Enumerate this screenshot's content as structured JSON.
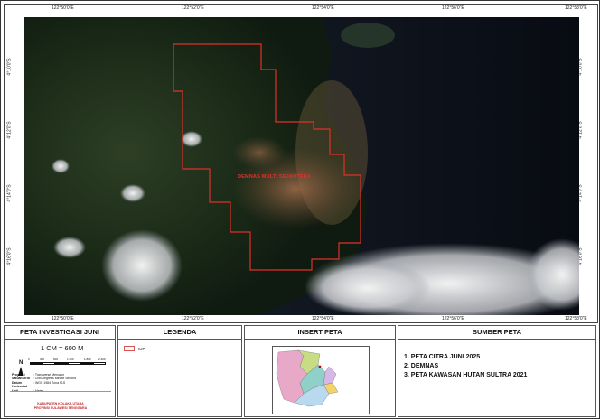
{
  "map": {
    "title": "PETA INVESTIGASI JUNI",
    "area_label": "DEMNAS MULTI SEJAHTERA",
    "top_coords": [
      "122°50'0\"E",
      "122°52'0\"E",
      "122°54'0\"E",
      "122°56'0\"E",
      "122°58'0\"E"
    ],
    "bottom_coords": [
      "122°50'0\"E",
      "122°52'0\"E",
      "122°54'0\"E",
      "122°56'0\"E",
      "122°58'0\"E"
    ],
    "left_coords": [
      "4°10'0\"S",
      "4°12'0\"S",
      "4°14'0\"S",
      "4°16'0\"S"
    ],
    "right_coords": [
      "4°10'0\"S",
      "4°12'0\"S",
      "4°14'0\"S",
      "4°16'0\"S"
    ],
    "boundary_color": "#e0302a"
  },
  "info": {
    "scale": "1 CM = 600 M",
    "north": "N",
    "bar_ticks": [
      "0",
      "300",
      "600",
      "1.200",
      "1.800",
      "2.400"
    ],
    "bar_unit": "Meters",
    "projection_rows": [
      {
        "k": "Proyeksi",
        "v": ": Transverse Mercator"
      },
      {
        "k": "Satuan Grid",
        "v": ": Grid Degrees Minute Second"
      },
      {
        "k": "Datum Horizontal",
        "v": ": WGS 1984 Zona 51S"
      },
      {
        "k": "Unit",
        "v": ": Meter"
      }
    ],
    "agency_line1": "KABUPATEN KOLAKA UTARA",
    "agency_line2": "PROVINSI SULAWESI TENGGARA"
  },
  "legend": {
    "title": "LEGENDA",
    "items": [
      {
        "label": "IUP",
        "color": "#d9534f"
      }
    ]
  },
  "inset": {
    "title": "INSERT PETA"
  },
  "sources": {
    "title": "SUMBER PETA",
    "items": [
      "1. PETA CITRA JUNI 2025",
      "2. DEMNAS",
      "3. PETA KAWASAN HUTAN SULTRA 2021"
    ]
  }
}
